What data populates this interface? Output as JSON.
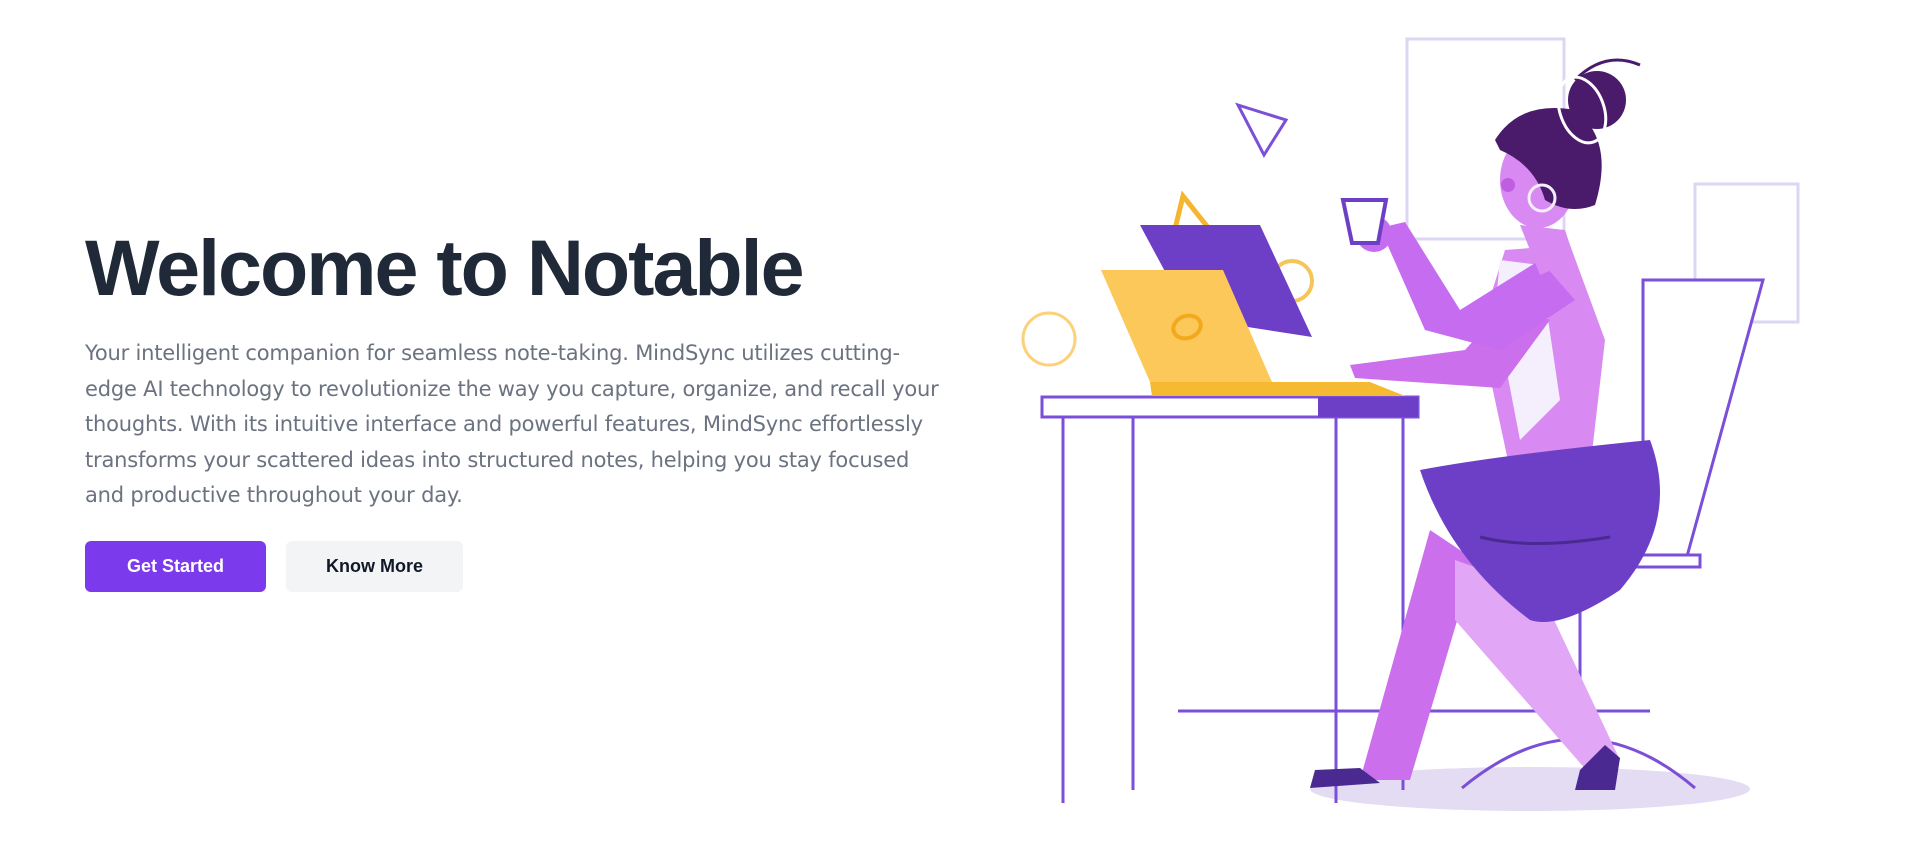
{
  "hero": {
    "title": "Welcome to Notable",
    "description": "Your intelligent companion for seamless note-taking. MindSync utilizes cutting-edge AI technology to revolutionize the way you capture, organize, and recall your thoughts. With its intuitive interface and powerful features, MindSync effortlessly transforms your scattered ideas into structured notes, helping you stay focused and productive throughout your day.",
    "primary_button": "Get Started",
    "secondary_button": "Know More"
  },
  "illustration": {
    "name": "woman-at-desk-with-laptop-illustration"
  },
  "colors": {
    "title": "#1f2937",
    "body_text": "#6b7280",
    "primary": "#7c3aed",
    "secondary_bg": "#f3f4f6",
    "illustration_purple": "#6d3fc7",
    "illustration_pink": "#d88af2",
    "illustration_yellow": "#fcc85a"
  }
}
